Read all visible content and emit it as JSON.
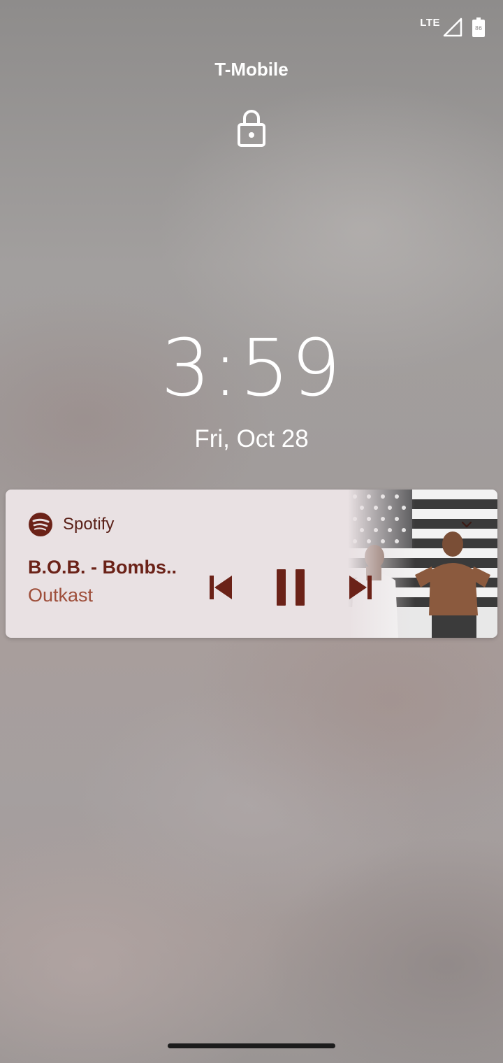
{
  "status_bar": {
    "network_label": "LTE",
    "battery_level": "86",
    "icons": [
      "signal-icon",
      "battery-icon"
    ]
  },
  "lockscreen": {
    "carrier": "T-Mobile",
    "lock_icon": "lock-icon",
    "time": "3:59",
    "date": "Fri, Oct 28"
  },
  "media": {
    "app_name": "Spotify",
    "app_icon": "spotify-icon",
    "title": "B.O.B. - Bombs..",
    "artist": "Outkast",
    "controls": [
      "previous-icon",
      "pause-icon",
      "next-icon"
    ],
    "expand_icon": "chevron-down-icon",
    "colors": {
      "card_bg": "#e9e1e3",
      "accent": "#6b2218",
      "artist": "#9e4e3a"
    }
  }
}
